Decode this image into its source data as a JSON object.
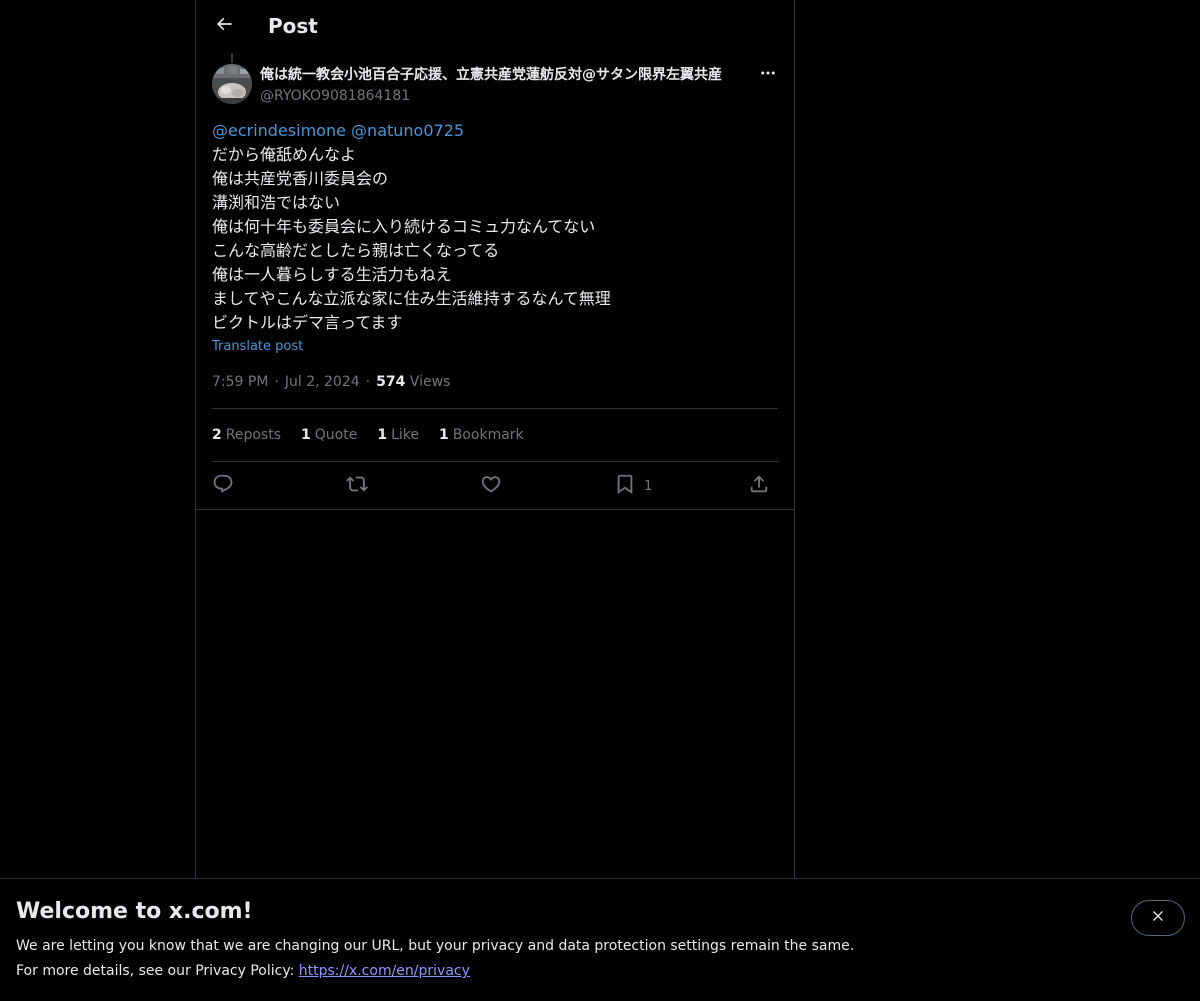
{
  "header": {
    "title": "Post",
    "back_icon": "arrow-left-icon"
  },
  "post": {
    "author": {
      "display_name": "俺は統一教会小池百合子応援、立憲共産党蓮舫反対@サタン限界左翼共産",
      "handle": "@RYOKO9081864181"
    },
    "mentions": [
      "@ecrindesimone",
      "@natuno0725"
    ],
    "lines": [
      "だから俺舐めんなよ",
      "俺は共産党香川委員会の",
      "溝渕和浩ではない",
      "俺は何十年も委員会に入り続けるコミュ力なんてない",
      "こんな高齢だとしたら親は亡くなってる",
      "俺は一人暮らしする生活力もねえ",
      "ましてやこんな立派な家に住み生活維持するなんて無理",
      "ビクトルはデマ言ってます"
    ],
    "translate_label": "Translate post",
    "time": "7:59 PM",
    "date": "Jul 2, 2024",
    "views_count": "574",
    "views_label": "Views",
    "meta_separator": "·"
  },
  "stats": {
    "reposts": {
      "count": "2",
      "label": "Reposts"
    },
    "quotes": {
      "count": "1",
      "label": "Quote"
    },
    "likes": {
      "count": "1",
      "label": "Like"
    },
    "bookmarks": {
      "count": "1",
      "label": "Bookmark"
    }
  },
  "actions": {
    "reply_icon": "reply-icon",
    "repost_icon": "repost-icon",
    "like_icon": "heart-icon",
    "bookmark_icon": "bookmark-icon",
    "bookmark_count": "1",
    "share_icon": "share-icon"
  },
  "banner": {
    "title": "Welcome to x.com!",
    "text1": "We are letting you know that we are changing our URL, but your privacy and data protection settings remain the same.",
    "text2_prefix": "For more details, see our Privacy Policy: ",
    "link": "https://x.com/en/privacy"
  },
  "colors": {
    "background": "#000000",
    "text": "#e7e9ea",
    "muted": "#71767b",
    "link": "#4b95d6",
    "border": "#2f3336"
  }
}
